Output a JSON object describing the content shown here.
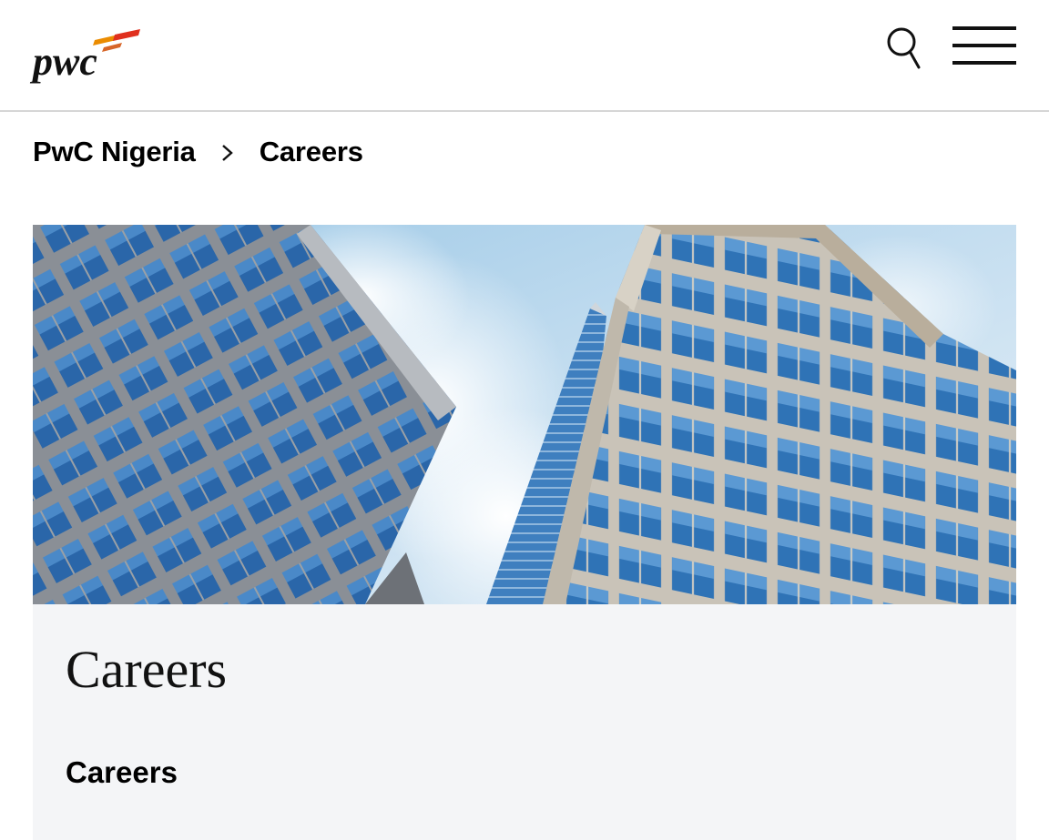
{
  "header": {
    "logo_text": "pwc",
    "search_icon": "search-icon",
    "menu_icon": "hamburger-menu-icon",
    "accent_colors": [
      "#e0301e",
      "#eb8c00",
      "#d04a02"
    ]
  },
  "breadcrumb": {
    "items": [
      {
        "label": "PwC Nigeria"
      },
      {
        "label": "Careers"
      }
    ],
    "separator_icon": "chevron-right-icon"
  },
  "hero": {
    "image_description_icon": "office-buildings-image",
    "sky_color": "#c9dfee",
    "glass_color": "#2f6fb4"
  },
  "content": {
    "page_title": "Careers",
    "section_heading": "Careers",
    "background_color": "#f4f5f7"
  }
}
